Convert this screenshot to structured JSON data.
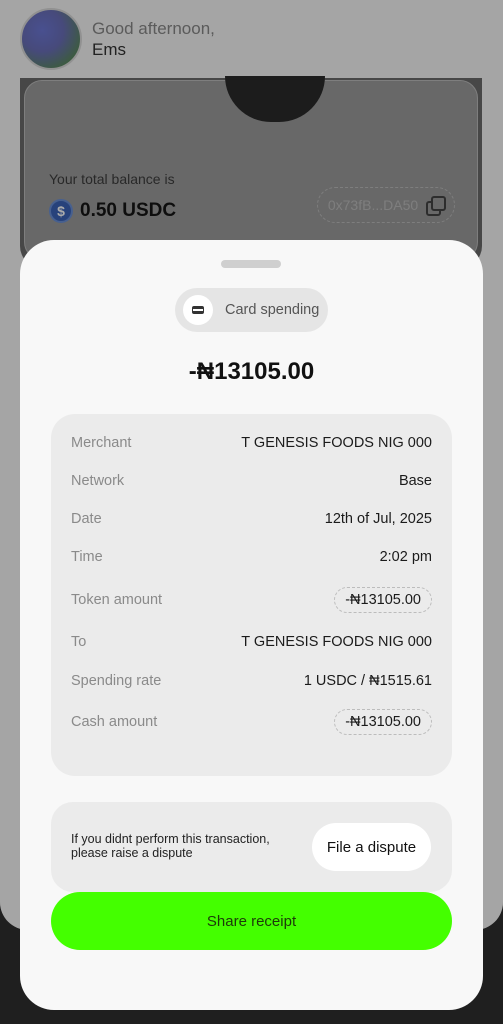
{
  "header": {
    "greeting": "Good afternoon,",
    "name": "Ems"
  },
  "balance": {
    "label": "Your total balance is",
    "currency_icon": "usdc-icon",
    "currency_glyph": "$",
    "value": "0.50 USDC",
    "address": "0x73fB...DA50"
  },
  "sheet": {
    "type_label": "Card spending",
    "amount": "-₦13105.00",
    "details": [
      {
        "key": "Merchant",
        "value": "T GENESIS FOODS NIG 000"
      },
      {
        "key": "Network",
        "value": "Base"
      },
      {
        "key": "Date",
        "value": "12th of Jul, 2025"
      },
      {
        "key": "Time",
        "value": "2:02 pm"
      },
      {
        "key": "Token amount",
        "value": "-₦13105.00"
      },
      {
        "key": "To",
        "value": "T GENESIS FOODS NIG 000"
      },
      {
        "key": "Spending rate",
        "value": "1 USDC / ₦1515.61"
      },
      {
        "key": "Cash amount",
        "value": "-₦13105.00"
      }
    ],
    "dispute_text": "If you didnt perform this transaction, please raise a dispute",
    "dispute_button": "File a dispute",
    "share_button": "Share receipt"
  },
  "colors": {
    "accent_green": "#44ff00"
  }
}
